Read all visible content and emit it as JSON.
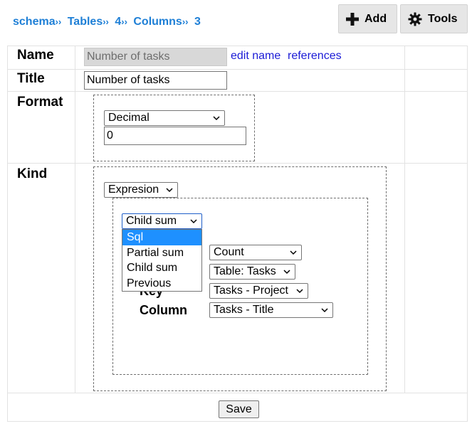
{
  "breadcrumb": {
    "items": [
      "schema",
      "Tables",
      "4",
      "Columns",
      "3"
    ],
    "separator": "››"
  },
  "toolbar": {
    "add_label": "Add",
    "tools_label": "Tools"
  },
  "rows": {
    "name": {
      "label": "Name",
      "value": "Number of tasks",
      "edit_name_link": "edit name",
      "references_link": "references"
    },
    "title": {
      "label": "Title",
      "value": "Number of tasks"
    },
    "format": {
      "label": "Format",
      "type_selected": "Decimal",
      "value": "0"
    },
    "kind": {
      "label": "Kind",
      "kind_selected": "Expresion",
      "child_select": "Child sum",
      "dropdown_options": [
        "Sql",
        "Partial sum",
        "Child sum",
        "Previous"
      ],
      "dropdown_highlighted": "Sql",
      "aggregate_select": "Count",
      "table_select": "Table: Tasks",
      "key_label": "Key",
      "key_select": "Tasks - Project",
      "column_label": "Column",
      "column_select": "Tasks - Title"
    }
  },
  "save_label": "Save",
  "colors": {
    "link_blue": "#1e7fd6",
    "highlight": "#1e90ff"
  }
}
